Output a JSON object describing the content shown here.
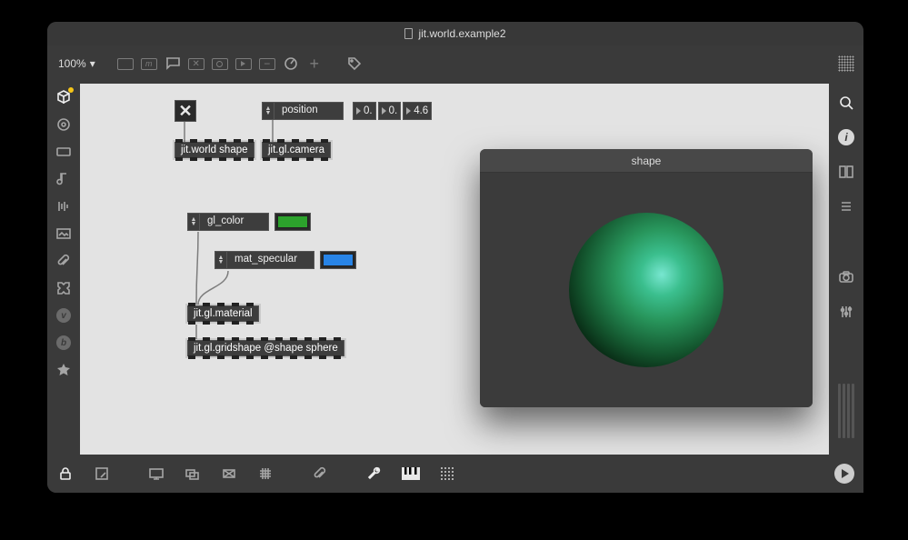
{
  "window": {
    "title": "jit.world.example2",
    "zoom": "100%"
  },
  "objects": {
    "toggle_on": "✕",
    "jit_world": "jit.world shape",
    "jit_gl_camera": "jit.gl.camera",
    "position_attr": "position",
    "position_values": [
      "0.",
      "0.",
      "4.6"
    ],
    "gl_color_attr": "gl_color",
    "mat_specular_attr": "mat_specular",
    "jit_gl_material": "jit.gl.material",
    "jit_gl_gridshape": "jit.gl.gridshape @shape sphere"
  },
  "render_window": {
    "title": "shape"
  },
  "colors": {
    "gl_color": "#2ca22c",
    "mat_specular": "#2884e6"
  },
  "left_icons": [
    "package-icon",
    "target-icon",
    "bpatcher-icon",
    "note-icon",
    "playback-icon",
    "image-icon",
    "attachment-icon",
    "plugin-icon",
    "v-icon",
    "b-icon",
    "star-icon"
  ],
  "right_icons": [
    "search-icon",
    "info-icon",
    "split-icon",
    "list-icon",
    "camera-icon",
    "mixer-icon"
  ],
  "top_icons": [
    "new-patcher-icon",
    "m-box-icon",
    "comment-box-icon",
    "x-box-icon",
    "circle-box-icon",
    "play-box-icon",
    "minus-box-icon",
    "dial-icon",
    "plus-icon",
    "tag-icon"
  ],
  "bottom_icons": [
    "lock-icon",
    "expand-icon",
    "presentation-icon",
    "layers-icon",
    "navigator-icon",
    "grid-toggle-icon",
    "paperclip-icon",
    "wrench-icon",
    "piano-icon",
    "dots-icon"
  ]
}
